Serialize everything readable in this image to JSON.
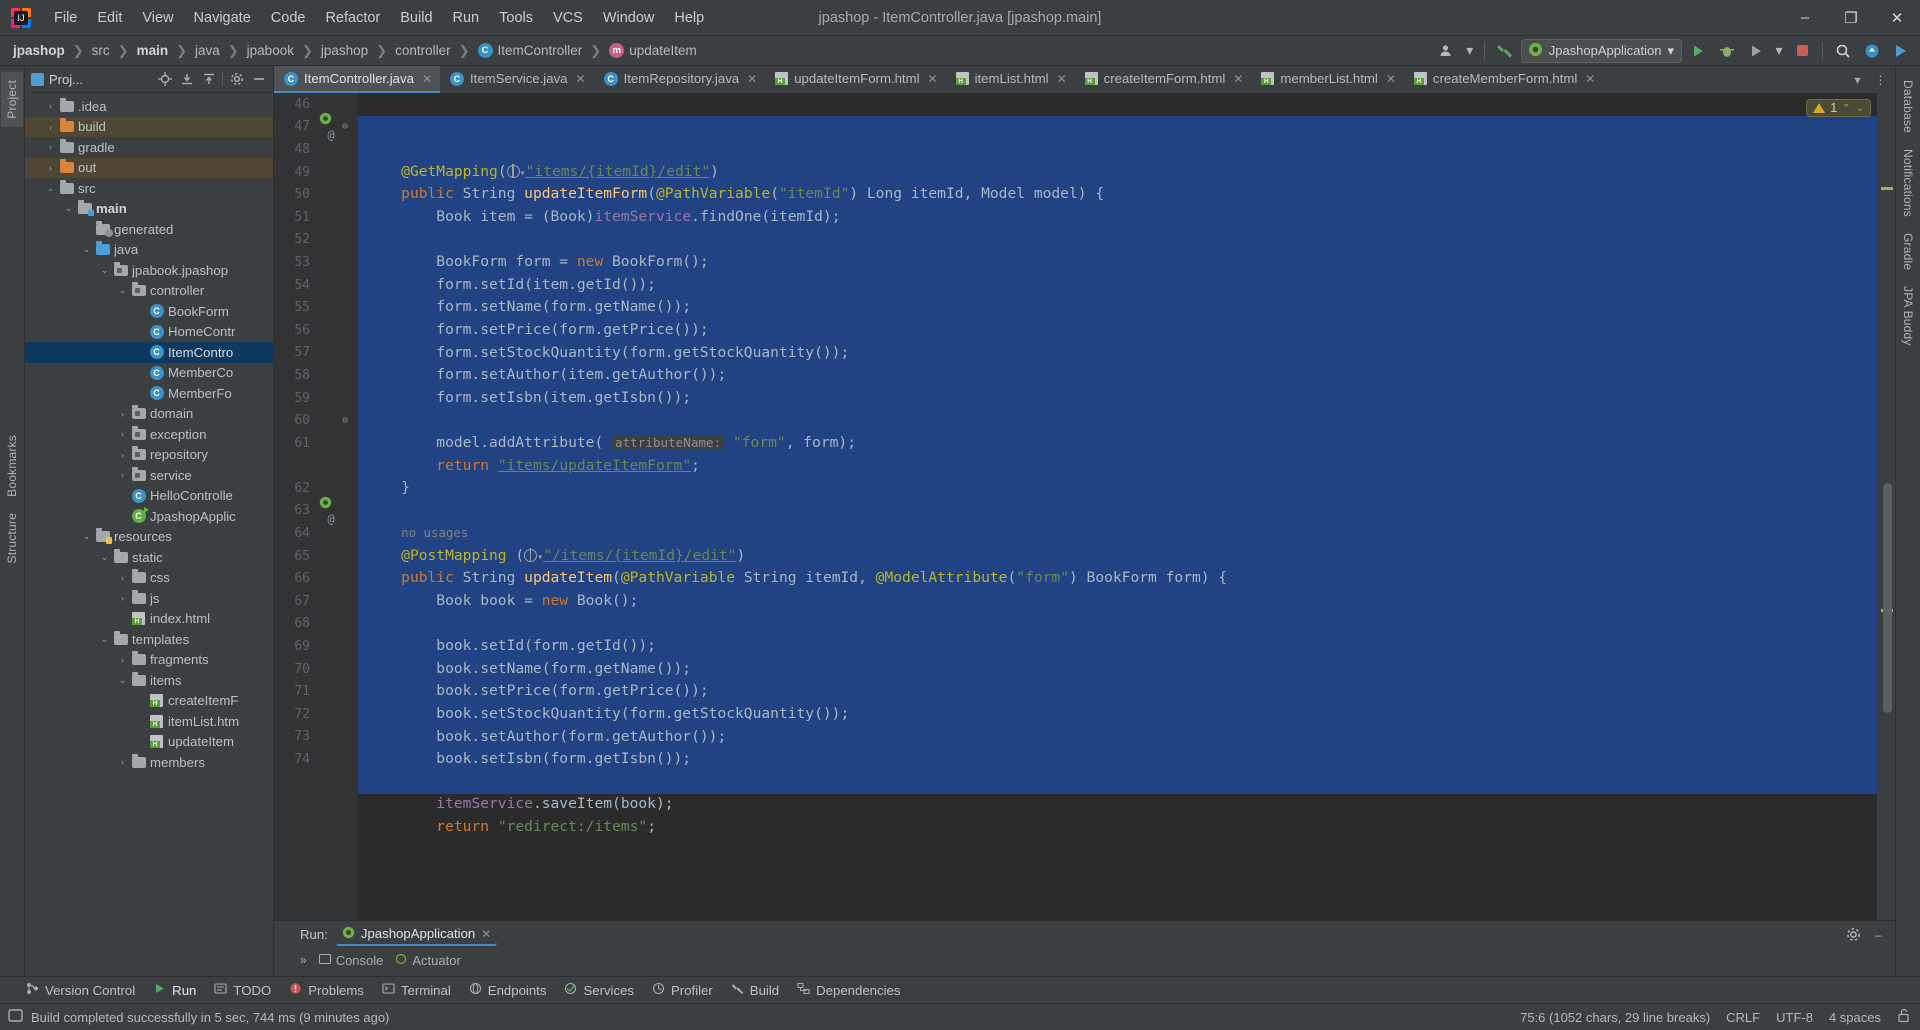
{
  "window": {
    "title": "jpashop - ItemController.java [jpashop.main]",
    "minimize": "–",
    "maximize": "❐",
    "close": "✕"
  },
  "menu": [
    {
      "label": "File"
    },
    {
      "label": "Edit"
    },
    {
      "label": "View"
    },
    {
      "label": "Navigate"
    },
    {
      "label": "Code"
    },
    {
      "label": "Refactor"
    },
    {
      "label": "Build"
    },
    {
      "label": "Run"
    },
    {
      "label": "Tools"
    },
    {
      "label": "VCS"
    },
    {
      "label": "Window"
    },
    {
      "label": "Help"
    }
  ],
  "breadcrumb": [
    {
      "label": "jpashop",
      "bold": true,
      "icon": ""
    },
    {
      "label": "src",
      "bold": false,
      "icon": ""
    },
    {
      "label": "main",
      "bold": true,
      "icon": ""
    },
    {
      "label": "java",
      "bold": false,
      "icon": ""
    },
    {
      "label": "jpabook",
      "bold": false,
      "icon": ""
    },
    {
      "label": "jpashop",
      "bold": false,
      "icon": ""
    },
    {
      "label": "controller",
      "bold": false,
      "icon": ""
    },
    {
      "label": "ItemController",
      "bold": false,
      "icon": "class-icon",
      "glyph": "C"
    },
    {
      "label": "updateItem",
      "bold": false,
      "icon": "method-icon",
      "glyph": "m"
    }
  ],
  "toolbar": {
    "run_config": "JpashopApplication",
    "run_config_dropdown": "▾",
    "account_icon": "user-account-icon",
    "hammer_icon": "build-hammer-icon",
    "run_icon": "run-icon",
    "debug_icon": "debug-icon",
    "run_with_coverage_icon": "coverage-icon",
    "more_run_icon": "▾",
    "stop_icon": "stop-icon",
    "search_icon": "⚲",
    "updates_icon": "updates-icon",
    "ide_icon": "ide-icon"
  },
  "project_panel": {
    "title": "Proj...",
    "tools": [
      "locate-icon",
      "collapse-all-icon",
      "expand-all-icon",
      "settings-gear-icon",
      "hide-icon"
    ],
    "tree": [
      {
        "label": ".idea",
        "depth": 1,
        "arrow": "›",
        "icon": "folder",
        "state": ""
      },
      {
        "label": "build",
        "depth": 1,
        "arrow": "›",
        "icon": "folder-orange",
        "state": "hl-build"
      },
      {
        "label": "gradle",
        "depth": 1,
        "arrow": "›",
        "icon": "folder",
        "state": ""
      },
      {
        "label": "out",
        "depth": 1,
        "arrow": "›",
        "icon": "folder-orange",
        "state": "hl-build"
      },
      {
        "label": "src",
        "depth": 1,
        "arrow": "⌄",
        "icon": "folder",
        "state": ""
      },
      {
        "label": "main",
        "depth": 2,
        "arrow": "⌄",
        "icon": "folder-src",
        "state": "",
        "bold": true
      },
      {
        "label": "generated",
        "depth": 3,
        "arrow": "",
        "icon": "folder-gen",
        "state": ""
      },
      {
        "label": "java",
        "depth": 3,
        "arrow": "⌄",
        "icon": "folder-blue",
        "state": ""
      },
      {
        "label": "jpabook.jpashop",
        "depth": 4,
        "arrow": "⌄",
        "icon": "folder-pkg",
        "state": ""
      },
      {
        "label": "controller",
        "depth": 5,
        "arrow": "⌄",
        "icon": "folder-pkg",
        "state": ""
      },
      {
        "label": "BookForm",
        "depth": 6,
        "arrow": "",
        "icon": "class",
        "state": ""
      },
      {
        "label": "HomeContr",
        "depth": 6,
        "arrow": "",
        "icon": "class",
        "state": ""
      },
      {
        "label": "ItemContro",
        "depth": 6,
        "arrow": "",
        "icon": "class",
        "state": "sel"
      },
      {
        "label": "MemberCo",
        "depth": 6,
        "arrow": "",
        "icon": "class",
        "state": ""
      },
      {
        "label": "MemberFo",
        "depth": 6,
        "arrow": "",
        "icon": "class",
        "state": ""
      },
      {
        "label": "domain",
        "depth": 5,
        "arrow": "›",
        "icon": "folder-pkg",
        "state": ""
      },
      {
        "label": "exception",
        "depth": 5,
        "arrow": "›",
        "icon": "folder-pkg",
        "state": ""
      },
      {
        "label": "repository",
        "depth": 5,
        "arrow": "›",
        "icon": "folder-pkg",
        "state": ""
      },
      {
        "label": "service",
        "depth": 5,
        "arrow": "›",
        "icon": "folder-pkg",
        "state": ""
      },
      {
        "label": "HelloControlle",
        "depth": 5,
        "arrow": "",
        "icon": "class",
        "state": ""
      },
      {
        "label": "JpashopApplic",
        "depth": 5,
        "arrow": "",
        "icon": "class-spring",
        "state": ""
      },
      {
        "label": "resources",
        "depth": 3,
        "arrow": "⌄",
        "icon": "folder-res",
        "state": ""
      },
      {
        "label": "static",
        "depth": 4,
        "arrow": "⌄",
        "icon": "folder",
        "state": ""
      },
      {
        "label": "css",
        "depth": 5,
        "arrow": "›",
        "icon": "folder",
        "state": ""
      },
      {
        "label": "js",
        "depth": 5,
        "arrow": "›",
        "icon": "folder",
        "state": ""
      },
      {
        "label": "index.html",
        "depth": 5,
        "arrow": "",
        "icon": "html",
        "state": ""
      },
      {
        "label": "templates",
        "depth": 4,
        "arrow": "⌄",
        "icon": "folder",
        "state": ""
      },
      {
        "label": "fragments",
        "depth": 5,
        "arrow": "›",
        "icon": "folder",
        "state": ""
      },
      {
        "label": "items",
        "depth": 5,
        "arrow": "⌄",
        "icon": "folder",
        "state": ""
      },
      {
        "label": "createItemF",
        "depth": 6,
        "arrow": "",
        "icon": "html",
        "state": ""
      },
      {
        "label": "itemList.htm",
        "depth": 6,
        "arrow": "",
        "icon": "html",
        "state": ""
      },
      {
        "label": "updateItem",
        "depth": 6,
        "arrow": "",
        "icon": "html",
        "state": ""
      },
      {
        "label": "members",
        "depth": 5,
        "arrow": "›",
        "icon": "folder",
        "state": ""
      }
    ]
  },
  "left_rail": [
    {
      "label": "Project",
      "selected": true
    },
    {
      "label": "Bookmarks",
      "selected": false
    },
    {
      "label": "Structure",
      "selected": false
    }
  ],
  "right_rail": [
    {
      "label": "Database",
      "selected": false
    },
    {
      "label": "Notifications",
      "selected": false
    },
    {
      "label": "Gradle",
      "selected": false
    },
    {
      "label": "JPA Buddy",
      "selected": false
    }
  ],
  "editor_tabs": [
    {
      "label": "ItemController.java",
      "icon": "class",
      "active": true
    },
    {
      "label": "ItemService.java",
      "icon": "class",
      "active": false
    },
    {
      "label": "ItemRepository.java",
      "icon": "class",
      "active": false
    },
    {
      "label": "updateItemForm.html",
      "icon": "html",
      "active": false
    },
    {
      "label": "itemList.html",
      "icon": "html",
      "active": false
    },
    {
      "label": "createItemForm.html",
      "icon": "html",
      "active": false
    },
    {
      "label": "memberList.html",
      "icon": "html",
      "active": false
    },
    {
      "label": "createMemberForm.html",
      "icon": "html",
      "active": false
    }
  ],
  "editor": {
    "warning_count": "1",
    "warning_up": "⌃",
    "warning_down": "⌄",
    "first_line_number": 46,
    "lines": [
      {
        "n": "46",
        "mark": "",
        "fold": "",
        "html": "    <span class=\"ann\">@GetMapping</span>(<span class=\"globe-ph\"></span><span class=\"strlink\">\"items/{itemId}/edit\"</span>)"
      },
      {
        "n": "47",
        "mark": "spring",
        "fold": "⊖",
        "html": "    <span class=\"kw\">public</span> String <span class=\"mth\">updateItemForm</span>(<span class=\"ann\">@PathVariable</span>(<span class=\"str\">\"itemId\"</span>) Long itemId, Model model) {"
      },
      {
        "n": "48",
        "mark": "",
        "fold": "",
        "html": "        Book item = (Book)<span class=\"fld\">itemService</span>.findOne(itemId);"
      },
      {
        "n": "49",
        "mark": "",
        "fold": "",
        "html": ""
      },
      {
        "n": "50",
        "mark": "",
        "fold": "",
        "html": "        BookForm form = <span class=\"kw\">new</span> BookForm();"
      },
      {
        "n": "51",
        "mark": "",
        "fold": "",
        "html": "        form.setId(item.getId());"
      },
      {
        "n": "52",
        "mark": "",
        "fold": "",
        "html": "        form.setName(form.getName());"
      },
      {
        "n": "53",
        "mark": "",
        "fold": "",
        "html": "        form.setPrice(form.getPrice());"
      },
      {
        "n": "54",
        "mark": "",
        "fold": "",
        "html": "        form.setStockQuantity(form.getStockQuantity());"
      },
      {
        "n": "55",
        "mark": "",
        "fold": "",
        "html": "        form.setAuthor(item.getAuthor());"
      },
      {
        "n": "56",
        "mark": "",
        "fold": "",
        "html": "        form.setIsbn(item.getIsbn());"
      },
      {
        "n": "57",
        "mark": "",
        "fold": "",
        "html": ""
      },
      {
        "n": "58",
        "mark": "",
        "fold": "",
        "html": "        model.addAttribute( <span class=\"hint\">attributeName:</span> <span class=\"str\">\"form\"</span>, form);"
      },
      {
        "n": "59",
        "mark": "",
        "fold": "",
        "html": "        <span class=\"kw\">return</span> <span class=\"strlink\">\"items/updateItemForm\"</span>;"
      },
      {
        "n": "60",
        "mark": "",
        "fold": "⊖",
        "html": "    }"
      },
      {
        "n": "61",
        "mark": "",
        "fold": "",
        "html": ""
      },
      {
        "n": "",
        "mark": "",
        "fold": "",
        "html": "    <span class=\"usg\">no usages</span>"
      },
      {
        "n": "62",
        "mark": "",
        "fold": "",
        "html": "    <span class=\"ann\">@PostMapping</span> (<span class=\"globe-ph\"></span><span class=\"strlink\">\"/items/{itemId}/edit\"</span>)"
      },
      {
        "n": "63",
        "mark": "spring",
        "fold": "",
        "html": "    <span class=\"kw\">public</span> String <span class=\"mth\">updateItem</span>(<span class=\"ann\">@PathVariable</span> String <span class=\"param\">itemId</span>, <span class=\"ann\">@ModelAttribute</span>(<span class=\"str\">\"form\"</span>) BookForm form) {"
      },
      {
        "n": "64",
        "mark": "",
        "fold": "",
        "html": "        Book book = <span class=\"kw\">new</span> Book();"
      },
      {
        "n": "65",
        "mark": "",
        "fold": "",
        "html": ""
      },
      {
        "n": "66",
        "mark": "",
        "fold": "",
        "html": "        book.setId(form.getId());"
      },
      {
        "n": "67",
        "mark": "",
        "fold": "",
        "html": "        book.setName(form.getName());"
      },
      {
        "n": "68",
        "mark": "",
        "fold": "",
        "html": "        book.setPrice(form.getPrice());"
      },
      {
        "n": "69",
        "mark": "",
        "fold": "",
        "html": "        book.setStockQuantity(form.getStockQuantity());"
      },
      {
        "n": "70",
        "mark": "",
        "fold": "",
        "html": "        book.setAuthor(form.getAuthor());"
      },
      {
        "n": "71",
        "mark": "",
        "fold": "",
        "html": "        book.setIsbn(form.getIsbn());"
      },
      {
        "n": "72",
        "mark": "",
        "fold": "",
        "html": ""
      },
      {
        "n": "73",
        "mark": "",
        "fold": "",
        "html": "        <span class=\"fld\">itemService</span>.saveItem(book);"
      },
      {
        "n": "74",
        "mark": "",
        "fold": "",
        "html": "        <span class=\"kw\">return</span> <span class=\"str\">\"redirect:/items\"</span>;"
      }
    ]
  },
  "run_panel": {
    "label": "Run:",
    "config_name": "JpashopApplication",
    "close": "✕",
    "settings_icon": "gear-icon",
    "hide_icon": "–",
    "expand_icon": "»",
    "sub_tabs": [
      {
        "label": "Console"
      },
      {
        "label": "Actuator"
      }
    ]
  },
  "tool_windows": [
    {
      "label": "Version Control",
      "icon": "branch-icon",
      "selected": false
    },
    {
      "label": "Run",
      "icon": "run-icon",
      "selected": true
    },
    {
      "label": "TODO",
      "icon": "todo-icon",
      "selected": false
    },
    {
      "label": "Problems",
      "icon": "problems-icon",
      "selected": false
    },
    {
      "label": "Terminal",
      "icon": "terminal-icon",
      "selected": false
    },
    {
      "label": "Endpoints",
      "icon": "endpoints-icon",
      "selected": false
    },
    {
      "label": "Services",
      "icon": "services-icon",
      "selected": false
    },
    {
      "label": "Profiler",
      "icon": "profiler-icon",
      "selected": false
    },
    {
      "label": "Build",
      "icon": "build-icon",
      "selected": false
    },
    {
      "label": "Dependencies",
      "icon": "dependencies-icon",
      "selected": false
    }
  ],
  "status_bar": {
    "message": "Build completed successfully in 5 sec, 744 ms (9 minutes ago)",
    "caret": "75:6 (1052 chars, 29 line breaks)",
    "line_separator": "CRLF",
    "encoding": "UTF-8",
    "indent": "4 spaces",
    "lock_icon": "unlock-icon",
    "memory_icon": "memory-indicator"
  },
  "colors": {
    "accent_blue": "#4a88c7",
    "selection": "#214283",
    "editor_bg": "#2b2b2b",
    "panel_bg": "#3c3f41",
    "tree_sel": "#0d385f",
    "warn": "#d4a935",
    "run_green": "#59a869"
  }
}
